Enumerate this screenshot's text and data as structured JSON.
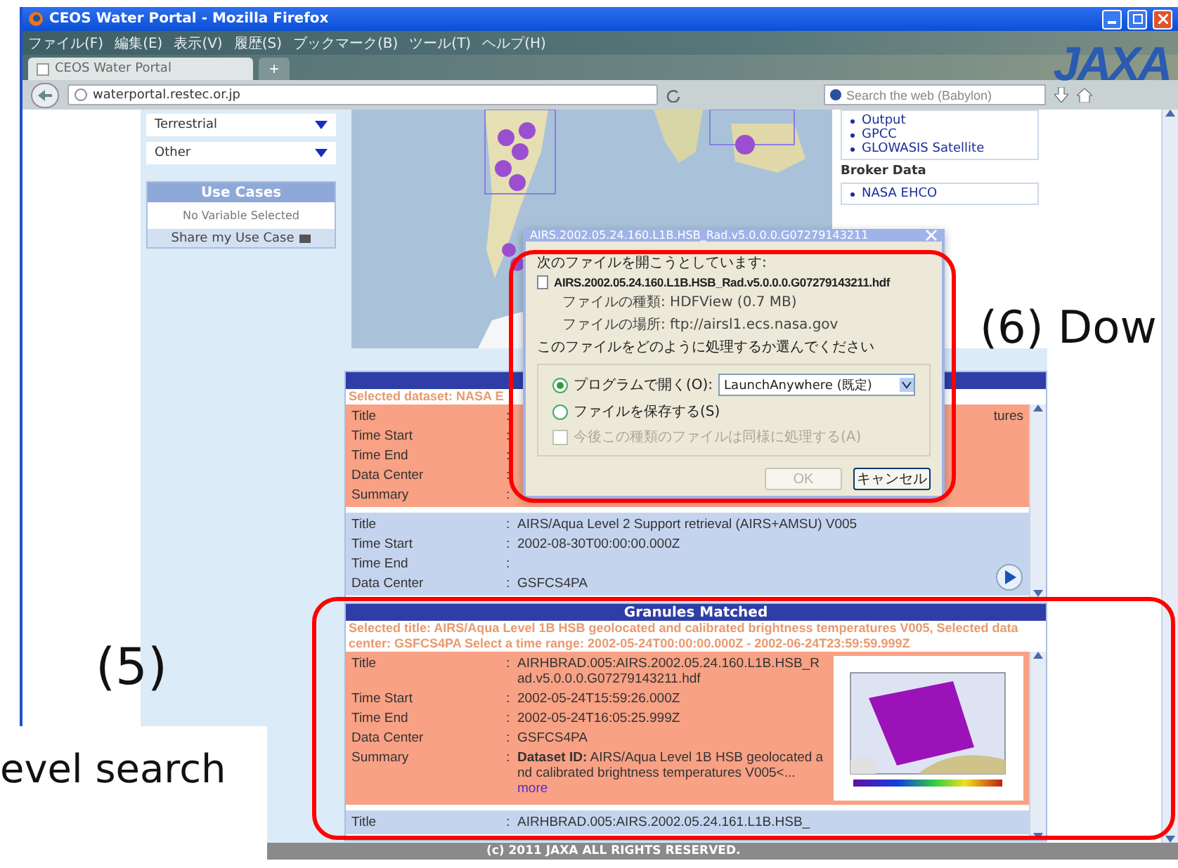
{
  "browser": {
    "title": "CEOS Water Portal - Mozilla Firefox",
    "menu": [
      "ファイル(F)",
      "編集(E)",
      "表示(V)",
      "履歴(S)",
      "ブックマーク(B)",
      "ツール(T)",
      "ヘルプ(H)"
    ],
    "tabs": [
      {
        "label": "CEOS Water Portal",
        "selected": true
      }
    ],
    "new_tab": "+",
    "url": "waterportal.restec.or.jp",
    "search": {
      "placeholder": "Search the web (Babylon)"
    },
    "logo": "JAXA"
  },
  "sidebar": {
    "dropdowns": [
      "Terrestrial",
      "Other"
    ],
    "use_cases": {
      "title": "Use Cases",
      "empty": "No Variable Selected",
      "share": "Share my Use Case"
    }
  },
  "data_list": {
    "items": [
      "Output",
      "GPCC",
      "GLOWASIS Satellite"
    ],
    "broker_title": "Broker Data",
    "broker_items": [
      "NASA EHCO"
    ]
  },
  "dataset_panel": {
    "separator": ":",
    "selected_text": "Selected dataset: NASA E",
    "records": [
      {
        "highlighted": true,
        "fields": [
          {
            "label": "Title",
            "value_tail": "tures"
          },
          {
            "label": "Time Start"
          },
          {
            "label": "Time End"
          },
          {
            "label": "Data Center"
          },
          {
            "label": "Summary"
          }
        ]
      },
      {
        "highlighted": false,
        "play": true,
        "fields": [
          {
            "label": "Title",
            "value": "AIRS/Aqua Level 2 Support retrieval (AIRS+AMSU) V005"
          },
          {
            "label": "Time Start",
            "value": "2002-08-30T00:00:00.000Z"
          },
          {
            "label": "Time End"
          },
          {
            "label": "Data Center",
            "value": "GSFCS4PA"
          }
        ]
      }
    ]
  },
  "granules_panel": {
    "separator": ":",
    "title": "Granules Matched",
    "description": "Selected title: AIRS/Aqua Level 1B HSB geolocated and calibrated brightness temperatures V005, Selected data center: GSFCS4PA Select a time range: 2002-05-24T00:00:00.000Z - 2002-06-24T23:59:59.999Z",
    "records": [
      {
        "highlighted": true,
        "fields": [
          {
            "label": "Title",
            "value": "AIRHBRAD.005:AIRS.2002.05.24.160.L1B.HSB_Rad.v5.0.0.0.G07279143211.hdf"
          },
          {
            "label": "Time Start",
            "value": "2002-05-24T15:59:26.000Z"
          },
          {
            "label": "Time End",
            "value": "2002-05-24T16:05:25.999Z"
          },
          {
            "label": "Data Center",
            "value": "GSFCS4PA"
          }
        ],
        "has_thumbnail": true,
        "summary": {
          "label": "Summary",
          "text": "**Dataset ID:** AIRS/Aqua Level 1B HSB geolocated and calibrated brightness temperatures V005<...",
          "link": "more"
        }
      },
      {
        "highlighted": false,
        "fields": [
          {
            "label": "Title",
            "value": "AIRHBRAD.005:AIRS.2002.05.24.161.L1B.HSB_"
          }
        ]
      }
    ]
  },
  "footer": "(c) 2011 JAXA ALL RIGHTS RESERVED.",
  "dialog": {
    "title": "AIRS.2002.05.24.160.L1B.HSB_Rad.v5.0.0.0.G07279143211",
    "intro": "次のファイルを開こうとしています:",
    "file_name": "AIRS.2002.05.24.160.L1B.HSB_Rad.v5.0.0.0.G07279143211.hdf",
    "file_type": "ファイルの種類: HDFView (0.7 MB)",
    "file_location": "ファイルの場所: ftp://airsl1.ecs.nasa.gov",
    "question": "このファイルをどのように処理するか選んでください",
    "options": [
      {
        "label": "プログラムで開く(O):",
        "selected": true,
        "program": "LaunchAnywhere (既定)"
      },
      {
        "label": "ファイルを保存する(S)",
        "selected": false
      }
    ],
    "remember": {
      "label": "今後この種類のファイルは同様に処理する(A)",
      "checked": false,
      "disabled": true
    },
    "buttons": [
      {
        "label": "OK",
        "disabled": true
      },
      {
        "label": "キャンセル",
        "disabled": false
      }
    ]
  },
  "annotations": {
    "step5": "(5)",
    "step6": "(6) Dow",
    "caption": "evel search"
  }
}
